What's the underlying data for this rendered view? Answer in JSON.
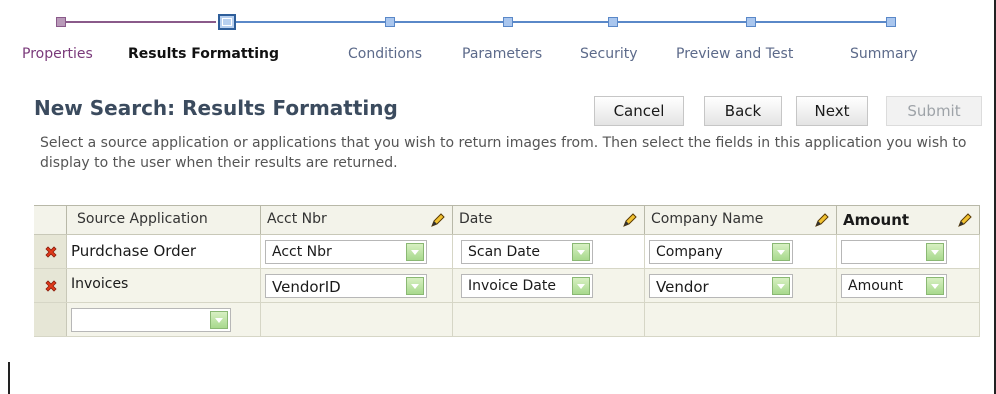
{
  "train": {
    "steps": [
      {
        "label": "Properties",
        "state": "done"
      },
      {
        "label": "Results Formatting",
        "state": "current"
      },
      {
        "label": "Conditions",
        "state": "todo"
      },
      {
        "label": "Parameters",
        "state": "todo"
      },
      {
        "label": "Security",
        "state": "todo"
      },
      {
        "label": "Preview and Test",
        "state": "todo"
      },
      {
        "label": "Summary",
        "state": "todo"
      }
    ],
    "colors": {
      "done": "#7a3a7a",
      "todo": "#5a88c8"
    }
  },
  "header": {
    "title": "New Search: Results Formatting",
    "buttons": {
      "cancel": "Cancel",
      "back": "Back",
      "next": "Next",
      "submit": "Submit"
    },
    "submit_disabled": true
  },
  "instructions": "Select a source application or applications that you wish to return images from. Then select the fields in this application you wish to display to the user when their results are returned.",
  "table": {
    "columns": [
      "Source Application",
      "Acct Nbr",
      "Date",
      "Company Name",
      "Amount"
    ],
    "rows": [
      {
        "source": "Purdchase Order",
        "acct": "Acct Nbr",
        "date": "Scan Date",
        "company": "Company",
        "amount": ""
      },
      {
        "source": "Invoices",
        "acct": "VendorID",
        "date": "Invoice Date",
        "company": "Vendor",
        "amount": "Amount"
      }
    ],
    "new_row_source": ""
  },
  "icons": {
    "delete": "delete-x-icon",
    "edit": "pencil-icon",
    "dropdown": "dropdown-arrow-icon"
  }
}
